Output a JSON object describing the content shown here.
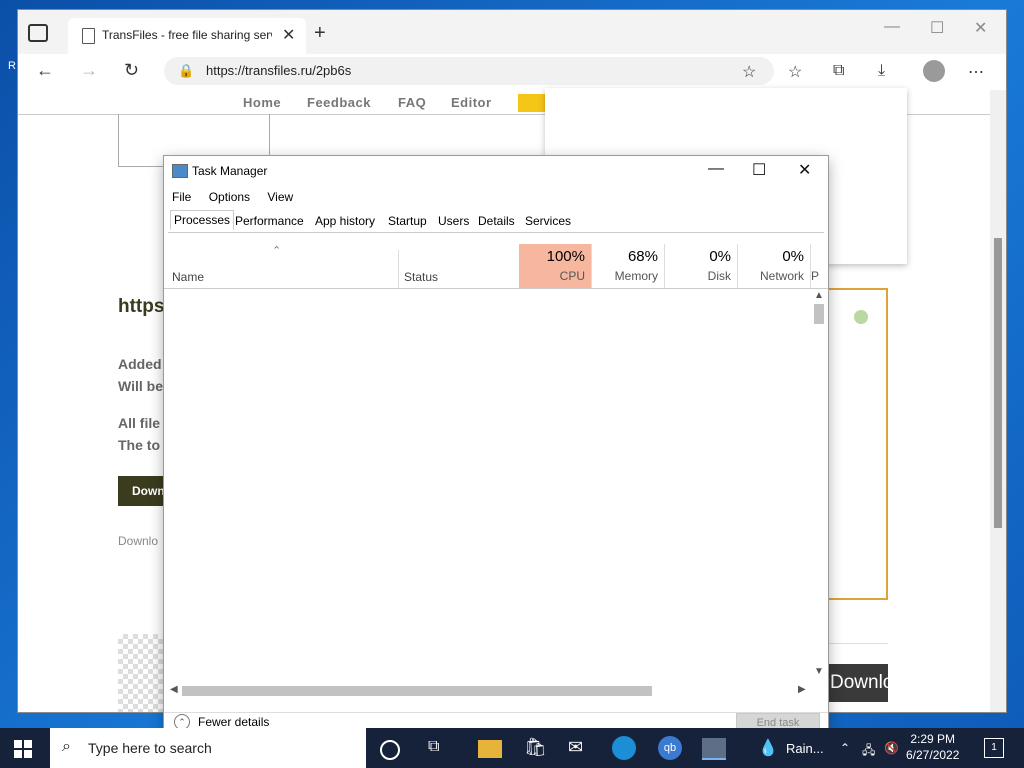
{
  "desktop": {
    "left_label": "R"
  },
  "browser": {
    "tab_title": "TransFiles - free file sharing servi",
    "url": "https://transfiles.ru/2pb6s",
    "nav": [
      "Home",
      "Feedback",
      "FAQ",
      "Editor"
    ],
    "page": {
      "heading": "https",
      "line1": "Added",
      "line2": "Will be",
      "line3": "All file",
      "line4": "The to",
      "download_button": "Down",
      "download_small": "Downlo",
      "download_big": "Downlo"
    }
  },
  "task_manager": {
    "title": "Task Manager",
    "menu": [
      "File",
      "Options",
      "View"
    ],
    "tabs": [
      "Processes",
      "Performance",
      "App history",
      "Startup",
      "Users",
      "Details",
      "Services"
    ],
    "columns": {
      "name": "Name",
      "status": "Status",
      "cpu": {
        "pct": "100%",
        "label": "CPU"
      },
      "memory": {
        "pct": "68%",
        "label": "Memory"
      },
      "disk": {
        "pct": "0%",
        "label": "Disk"
      },
      "network": {
        "pct": "0%",
        "label": "Network"
      },
      "power": {
        "label": "P"
      }
    },
    "fewer_details": "Fewer details",
    "end_task": "End task"
  },
  "taskbar": {
    "search_placeholder": "Type here to search",
    "pinned_label": "Rain...",
    "time": "2:29 PM",
    "date": "6/27/2022",
    "notifications": "1"
  },
  "colors": {
    "cpu_highlight": "#f7b79e",
    "taskbar": "#16213a",
    "accent": "#0a64c8"
  }
}
